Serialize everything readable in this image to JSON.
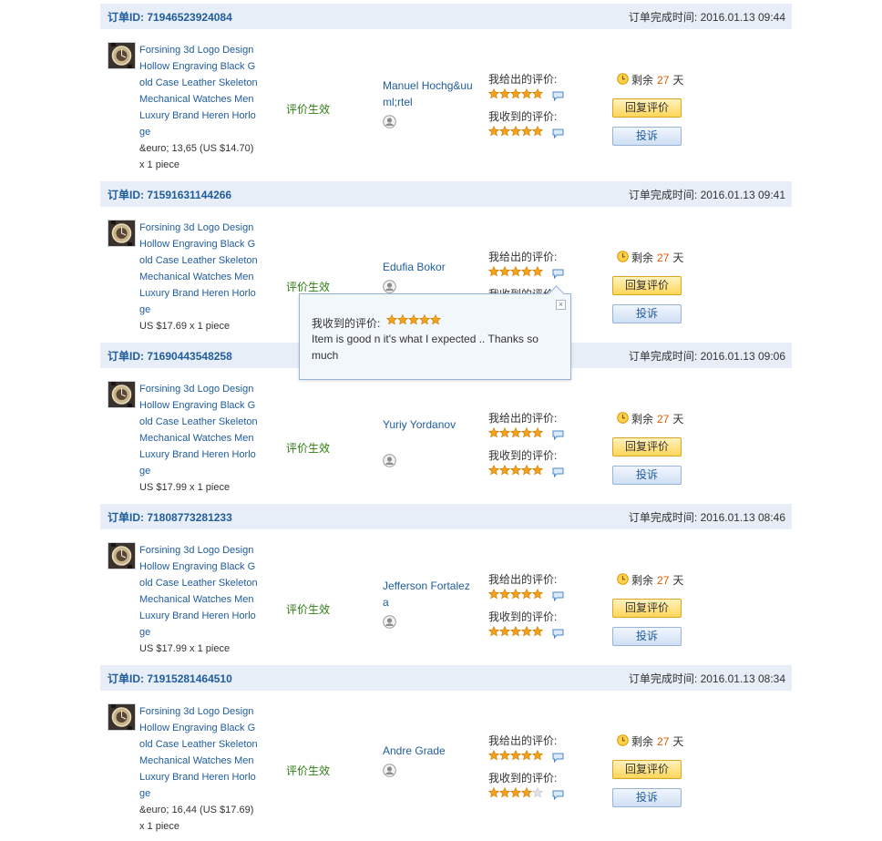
{
  "labels": {
    "order_id_prefix": "订单ID:",
    "completed_prefix": "订单完成时间:",
    "status": "评价生效",
    "given": "我给出的评价:",
    "received": "我收到的评价:",
    "remain_prefix": "剩余",
    "remain_unit": "天",
    "reply": "回复评价",
    "complain": "投诉"
  },
  "colors": {
    "accent": "#1f5c9c",
    "header_bg": "#e8eef8",
    "status_green": "#2f7d14",
    "remain_orange": "#e05a00"
  },
  "orders": [
    {
      "order_id": "订单ID: 71946523924084",
      "completed": "订单完成时间: 2016.01.13 09:44",
      "product": "Forsining 3d Logo Design Hollow Engraving Black Gold Case Leather Skeleton Mechanical Watches Men Luxury Brand Heren Horloge",
      "price_line1": "&euro; 13,65 (US $14.70)",
      "price_line2": "x 1 piece",
      "status": "评价生效",
      "buyer": "Manuel Hochg&uuml;rtel",
      "given_label": "我给出的评价:",
      "given_stars": 5,
      "received_label": "我收到的评价:",
      "received_stars": 5,
      "remain_prefix": "剩余",
      "remain_days": "27",
      "remain_unit": "天",
      "reply": "回复评价",
      "complain": "投诉"
    },
    {
      "order_id": "订单ID: 71591631144266",
      "completed": "订单完成时间: 2016.01.13 09:41",
      "product": "Forsining 3d Logo Design Hollow Engraving Black Gold Case Leather Skeleton Mechanical Watches Men Luxury Brand Heren Horloge",
      "price_line1": "US $17.69 x 1 piece",
      "price_line2": "",
      "status": "评价生效",
      "buyer": "Edufia Bokor",
      "given_label": "我给出的评价:",
      "given_stars": 5,
      "received_label": "我收到的评价:",
      "received_stars": 5,
      "remain_prefix": "剩余",
      "remain_days": "27",
      "remain_unit": "天",
      "reply": "回复评价",
      "complain": "投诉"
    },
    {
      "order_id": "订单ID: 71690443548258",
      "completed": "订单完成时间: 2016.01.13 09:06",
      "product": "Forsining 3d Logo Design Hollow Engraving Black Gold Case Leather Skeleton Mechanical Watches Men Luxury Brand Heren Horloge",
      "price_line1": "US $17.99 x 1 piece",
      "price_line2": "",
      "status": "评价生效",
      "buyer": "Yuriy Yordanov",
      "given_label": "我给出的评价:",
      "given_stars": 5,
      "received_label": "我收到的评价:",
      "received_stars": 5,
      "remain_prefix": "剩余",
      "remain_days": "27",
      "remain_unit": "天",
      "reply": "回复评价",
      "complain": "投诉"
    },
    {
      "order_id": "订单ID: 71808773281233",
      "completed": "订单完成时间: 2016.01.13 08:46",
      "product": "Forsining 3d Logo Design Hollow Engraving Black Gold Case Leather Skeleton Mechanical Watches Men Luxury Brand Heren Horloge",
      "price_line1": "US $17.99 x 1 piece",
      "price_line2": "",
      "status": "评价生效",
      "buyer": "Jefferson Fortaleza",
      "given_label": "我给出的评价:",
      "given_stars": 5,
      "received_label": "我收到的评价:",
      "received_stars": 5,
      "remain_prefix": "剩余",
      "remain_days": "27",
      "remain_unit": "天",
      "reply": "回复评价",
      "complain": "投诉"
    },
    {
      "order_id": "订单ID: 71915281464510",
      "completed": "订单完成时间: 2016.01.13 08:34",
      "product": "Forsining 3d Logo Design Hollow Engraving Black Gold Case Leather Skeleton Mechanical Watches Men Luxury Brand Heren Horloge",
      "price_line1": "&euro; 16,44 (US $17.69)",
      "price_line2": "x 1 piece",
      "status": "评价生效",
      "buyer": "Andre Grade",
      "given_label": "我给出的评价:",
      "given_stars": 5,
      "received_label": "我收到的评价:",
      "received_stars": 4,
      "remain_prefix": "剩余",
      "remain_days": "27",
      "remain_unit": "天",
      "reply": "回复评价",
      "complain": "投诉"
    }
  ],
  "popup": {
    "label": "我收到的评价:",
    "stars": 5,
    "text": "Item is good n it's what I expected .. Thanks so much",
    "close_icon": "close-icon"
  }
}
